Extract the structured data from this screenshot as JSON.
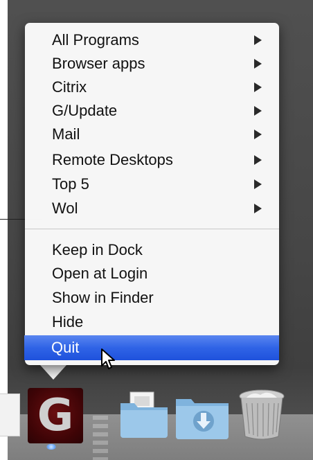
{
  "menu": {
    "submenu_items": [
      {
        "label": "All Programs"
      },
      {
        "label": "Browser apps"
      },
      {
        "label": "Citrix"
      },
      {
        "label": "G/Update"
      },
      {
        "label": "Mail"
      },
      {
        "label": "Remote Desktops"
      },
      {
        "label": "Top 5"
      },
      {
        "label": "Wol"
      }
    ],
    "action_items": [
      {
        "label": "Keep in Dock"
      },
      {
        "label": "Open at Login"
      },
      {
        "label": "Show in Finder"
      },
      {
        "label": "Hide"
      }
    ],
    "selected_item": {
      "label": "Quit"
    },
    "highlight_color": "#2f63e6"
  },
  "dock": {
    "app_icon_letter": "G",
    "items": [
      {
        "icon": "document-icon"
      },
      {
        "icon": "app-g-icon"
      },
      {
        "icon": "documents-folder-icon"
      },
      {
        "icon": "downloads-folder-icon"
      },
      {
        "icon": "trash-icon"
      }
    ]
  }
}
